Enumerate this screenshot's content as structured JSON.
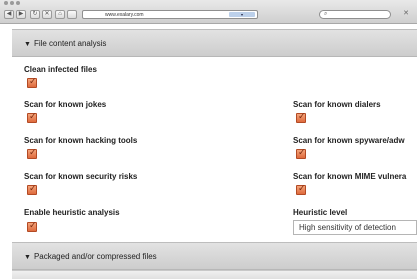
{
  "browser": {
    "url": "www.exalary.com",
    "go_label": "▾",
    "back_glyph": "◀",
    "forward_glyph": "▶",
    "reload_glyph": "↻",
    "stop_glyph": "✕",
    "home_glyph": "⌂",
    "search_icon_glyph": "⌕",
    "close_glyph": "✕"
  },
  "sections": [
    {
      "title": "File content analysis",
      "expanded": true
    },
    {
      "title": "Packaged and/or compressed files",
      "expanded": true
    }
  ],
  "options": {
    "clean_infected": {
      "label": "Clean infected files",
      "checked": true
    },
    "jokes": {
      "label": "Scan for known jokes",
      "checked": true
    },
    "dialers": {
      "label": "Scan for known dialers",
      "checked": true
    },
    "hacking_tools": {
      "label": "Scan for known hacking tools",
      "checked": true
    },
    "spyware": {
      "label": "Scan for known spyware/adw",
      "checked": true
    },
    "security_risks": {
      "label": "Scan for known security risks",
      "checked": true
    },
    "mime": {
      "label": "Scan for known MIME vulnera",
      "checked": true
    },
    "heuristic": {
      "label": "Enable heuristic analysis",
      "checked": true
    }
  },
  "heuristic_level": {
    "label": "Heuristic level",
    "value": "High sensitivity of detection"
  },
  "colors": {
    "checkbox_fill": "#de6a3d",
    "section_bg": "#d8d8d8"
  }
}
